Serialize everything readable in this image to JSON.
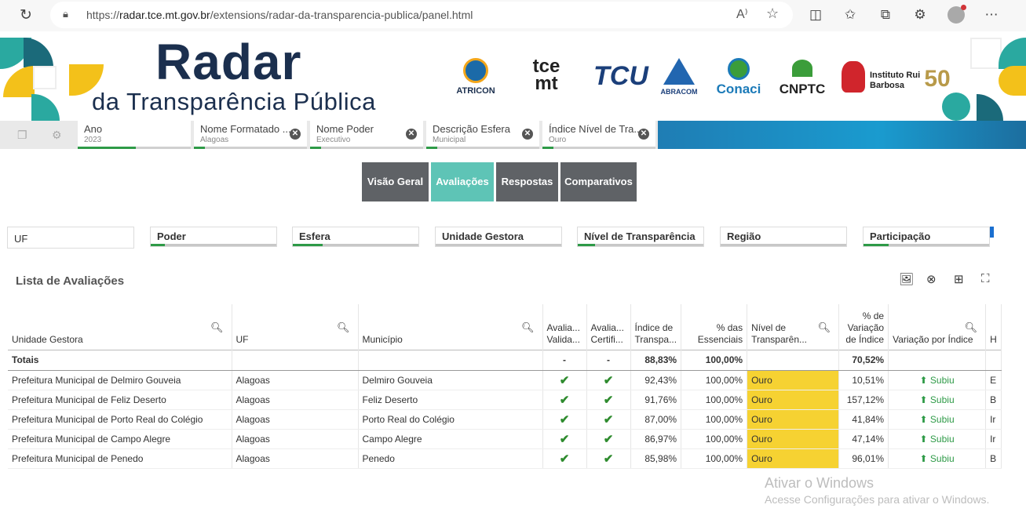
{
  "browser": {
    "url_prefix": "https://",
    "url_host": "radar.tce.mt.gov.br",
    "url_path": "/extensions/radar-da-transparencia-publica/panel.html"
  },
  "banner": {
    "title": "Radar",
    "subtitle": "da Transparência Pública",
    "logos": [
      "ATRICON",
      "tce mt",
      "TCU",
      "ABRACOM",
      "Conaci",
      "CNPTC",
      "Instituto Rui Barbosa",
      "50"
    ]
  },
  "selections": [
    {
      "label": "Ano",
      "value": "2023"
    },
    {
      "label": "Nome Formatado ...",
      "value": "Alagoas"
    },
    {
      "label": "Nome Poder",
      "value": "Executivo"
    },
    {
      "label": "Descrição Esfera",
      "value": "Municipal"
    },
    {
      "label": "Índice Nível de Tra...",
      "value": "Ouro"
    }
  ],
  "tabs": [
    "Visão Geral",
    "Avaliações",
    "Respostas",
    "Comparativos"
  ],
  "filters": [
    "UF",
    "Poder",
    "Esfera",
    "Unidade Gestora",
    "Nível de Transparência",
    "Região",
    "Participação"
  ],
  "panel": {
    "title": "Lista de Avaliações"
  },
  "table": {
    "headers": [
      "Unidade Gestora",
      "UF",
      "Município",
      "Avalia... Valida...",
      "Avalia... Certifi...",
      "Índice de Transpa...",
      "% das Essenciais",
      "Nível de Transparên...",
      "% de Variação de Índice",
      "Variação por Índice",
      "H"
    ],
    "totals": {
      "label": "Totais",
      "val1": "-",
      "val2": "-",
      "indice": "88,83%",
      "essenciais": "100,00%",
      "variacao": "70,52%"
    },
    "rows": [
      {
        "unidade": "Prefeitura Municipal de Delmiro Gouveia",
        "uf": "Alagoas",
        "municipio": "Delmiro Gouveia",
        "indice": "92,43%",
        "essenciais": "100,00%",
        "nivel": "Ouro",
        "variacao": "10,51%",
        "var_indice": "Subiu",
        "h": "E"
      },
      {
        "unidade": "Prefeitura Municipal de Feliz Deserto",
        "uf": "Alagoas",
        "municipio": "Feliz Deserto",
        "indice": "91,76%",
        "essenciais": "100,00%",
        "nivel": "Ouro",
        "variacao": "157,12%",
        "var_indice": "Subiu",
        "h": "B"
      },
      {
        "unidade": "Prefeitura Municipal de Porto Real do Colégio",
        "uf": "Alagoas",
        "municipio": "Porto Real do Colégio",
        "indice": "87,00%",
        "essenciais": "100,00%",
        "nivel": "Ouro",
        "variacao": "41,84%",
        "var_indice": "Subiu",
        "h": "Ir"
      },
      {
        "unidade": "Prefeitura Municipal de Campo Alegre",
        "uf": "Alagoas",
        "municipio": "Campo Alegre",
        "indice": "86,97%",
        "essenciais": "100,00%",
        "nivel": "Ouro",
        "variacao": "47,14%",
        "var_indice": "Subiu",
        "h": "Ir"
      },
      {
        "unidade": "Prefeitura Municipal de Penedo",
        "uf": "Alagoas",
        "municipio": "Penedo",
        "indice": "85,98%",
        "essenciais": "100,00%",
        "nivel": "Ouro",
        "variacao": "96,01%",
        "var_indice": "Subiu",
        "h": "B"
      }
    ]
  },
  "watermark": {
    "line1": "Ativar o Windows",
    "line2": "Acesse Configurações para ativar o Windows."
  }
}
